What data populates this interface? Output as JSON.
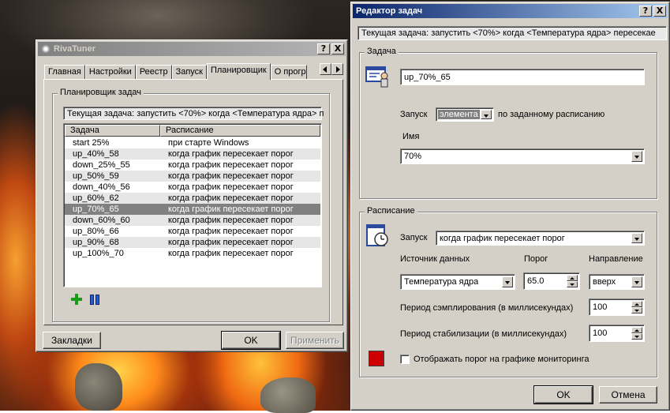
{
  "rivatuner": {
    "title": "RivaTuner",
    "tabs": [
      "Главная",
      "Настройки",
      "Реестр",
      "Запуск",
      "Планировщик",
      "О прогр"
    ],
    "active_tab": "Планировщик",
    "group_label": "Планировщик задач",
    "current_task": "Текущая задача: запустить <70%> когда <Температура ядра> п",
    "columns": [
      "Задача",
      "Расписание"
    ],
    "rows": [
      {
        "task": "start 25%",
        "schedule": "при старте Windows"
      },
      {
        "task": "up_40%_58",
        "schedule": "когда график пересекает порог"
      },
      {
        "task": "down_25%_55",
        "schedule": "когда график пересекает порог"
      },
      {
        "task": "up_50%_59",
        "schedule": "когда график пересекает порог"
      },
      {
        "task": "down_40%_56",
        "schedule": "когда график пересекает порог"
      },
      {
        "task": "up_60%_62",
        "schedule": "когда график пересекает порог"
      },
      {
        "task": "up_70%_65",
        "schedule": "когда график пересекает порог"
      },
      {
        "task": "down_60%_60",
        "schedule": "когда график пересекает порог"
      },
      {
        "task": "up_80%_66",
        "schedule": "когда график пересекает порог"
      },
      {
        "task": "up_90%_68",
        "schedule": "когда график пересекает порог"
      },
      {
        "task": "up_100%_70",
        "schedule": "когда график пересекает порог"
      }
    ],
    "selected_row": 6,
    "bookmarks_label": "Закладки",
    "ok_label": "OK",
    "apply_label": "Применить"
  },
  "editor": {
    "title": "Редактор задач",
    "current_task": "Текущая задача: запустить <70%> когда <Температура ядра> пересекае",
    "task_group_label": "Задача",
    "task_name": "up_70%_65",
    "launch_label": "Запуск",
    "launch_value": "элемента",
    "launch_suffix": "по заданному расписанию",
    "name_label": "Имя",
    "name_value": "70%",
    "schedule_group_label": "Расписание",
    "schedule_launch_label": "Запуск",
    "schedule_launch_value": "когда график пересекает порог",
    "source_label": "Источник данных",
    "threshold_label": "Порог",
    "direction_label": "Направление",
    "source_value": "Температура ядра",
    "threshold_value": "65.0",
    "direction_value": "вверх",
    "sampling_label": "Период сэмплирования (в миллисекундах)",
    "sampling_value": "100",
    "stabilization_label": "Период стабилизации (в миллисекундах)",
    "stabilization_value": "100",
    "show_threshold_label": "Отображать порог на графике мониторинга",
    "threshold_color": "#cc0000",
    "ok_label": "OK",
    "cancel_label": "Отмена"
  },
  "title_buttons": {
    "help": "?",
    "close": "X"
  }
}
